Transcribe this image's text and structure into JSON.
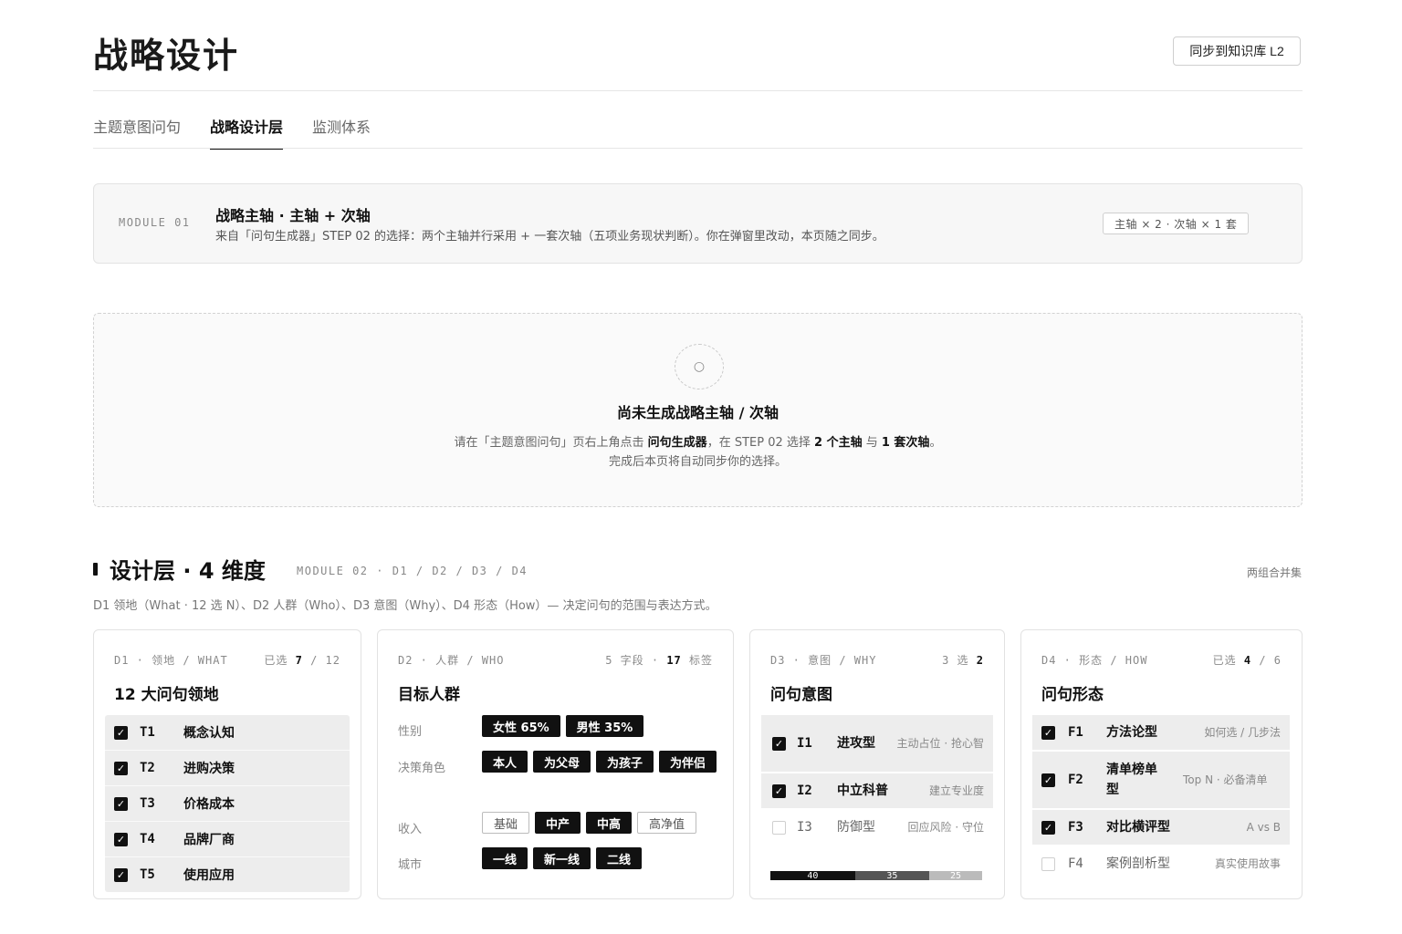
{
  "header": {
    "title": "战略设计",
    "sync_button": "同步到知识库 L2"
  },
  "tabs": [
    {
      "label": "主题意图问句",
      "active": false
    },
    {
      "label": "战略设计层",
      "active": true
    },
    {
      "label": "监测体系",
      "active": false
    }
  ],
  "module01": {
    "tag": "MODULE 01",
    "title": "战略主轴 · 主轴 + 次轴",
    "desc": "来自「问句生成器」STEP 02 的选择：两个主轴并行采用 + 一套次轴（五项业务现状判断）。你在弹窗里改动，本页随之同步。",
    "badge": "主轴 × 2 · 次轴 × 1 套"
  },
  "empty_state": {
    "icon": "circle-icon",
    "icon_glyph": "○",
    "title": "尚未生成战略主轴 / 次轴",
    "line1_a": "请在「主题意图问句」页右上角点击 ",
    "line1_b": "问句生成器",
    "line1_c": "，在 STEP 02 选择 ",
    "line1_d": "2 个主轴",
    "line1_e": " 与 ",
    "line1_f": "1 套次轴",
    "line1_g": "。",
    "line2": "完成后本页将自动同步你的选择。"
  },
  "module02": {
    "title": "设计层 · 4 维度",
    "sub": "MODULE 02 · D1 / D2 / D3 / D4",
    "right": "两组合并集",
    "desc": "D1 领地（What · 12 选 N）、D2 人群（Who）、D3 意图（Why）、D4 形态（How）— 决定问句的范围与表达方式。"
  },
  "cards": {
    "d1": {
      "head_left": "D1 · 领地 / WHAT",
      "head_right_a": "已选 ",
      "head_right_b": "7",
      "head_right_c": " / 12",
      "title": "12 大问句领地",
      "items": [
        {
          "code": "T1",
          "label": "概念认知"
        },
        {
          "code": "T2",
          "label": "进购决策"
        },
        {
          "code": "T3",
          "label": "价格成本"
        },
        {
          "code": "T4",
          "label": "品牌厂商"
        },
        {
          "code": "T5",
          "label": "使用应用"
        }
      ]
    },
    "d2": {
      "head_left": "D2 · 人群 / WHO",
      "head_right_a": "5 字段 · ",
      "head_right_b": "17",
      "head_right_c": " 标签",
      "title": "目标人群",
      "groups": [
        {
          "label": "性别",
          "tags": [
            {
              "text": "女性 65%",
              "on": true
            },
            {
              "text": "男性 35%",
              "on": true
            }
          ]
        },
        {
          "label": "决策角色",
          "tags": [
            {
              "text": "本人",
              "on": true
            },
            {
              "text": "为父母",
              "on": true
            },
            {
              "text": "为孩子",
              "on": true
            },
            {
              "text": "为伴侣",
              "on": true
            }
          ]
        },
        {
          "label": "收入",
          "tags": [
            {
              "text": "基础",
              "on": false
            },
            {
              "text": "中产",
              "on": true
            },
            {
              "text": "中高",
              "on": true
            },
            {
              "text": "高净值",
              "on": false
            }
          ]
        },
        {
          "label": "城市",
          "tags": [
            {
              "text": "一线",
              "on": true
            },
            {
              "text": "新一线",
              "on": true
            },
            {
              "text": "二线",
              "on": true
            }
          ]
        }
      ]
    },
    "d3": {
      "head_left": "D3 · 意图 / WHY",
      "head_right_a": "3 选 ",
      "head_right_b": "2",
      "head_right_c": "",
      "title": "问句意图",
      "items": [
        {
          "code": "I1",
          "label": "进攻型",
          "note": "主动占位 · 抢心智",
          "on": true
        },
        {
          "code": "I2",
          "label": "中立科普",
          "note": "建立专业度",
          "on": true
        },
        {
          "code": "I3",
          "label": "防御型",
          "note": "回应风险 · 守位",
          "on": false
        }
      ],
      "distribution": [
        {
          "value": 40,
          "color": "#111111"
        },
        {
          "value": 35,
          "color": "#555555"
        },
        {
          "value": 25,
          "color": "#bbbbbb"
        }
      ]
    },
    "d4": {
      "head_left": "D4 · 形态 / HOW",
      "head_right_a": "已选 ",
      "head_right_b": "4",
      "head_right_c": " / 6",
      "title": "问句形态",
      "items": [
        {
          "code": "F1",
          "label": "方法论型",
          "note": "如何选 / 几步法",
          "on": true
        },
        {
          "code": "F2",
          "label": "清单榜单型",
          "note": "Top N · 必备清单",
          "on": true
        },
        {
          "code": "F3",
          "label": "对比横评型",
          "note": "A vs B",
          "on": true
        },
        {
          "code": "F4",
          "label": "案例剖析型",
          "note": "真实使用故事",
          "on": false
        }
      ]
    }
  }
}
